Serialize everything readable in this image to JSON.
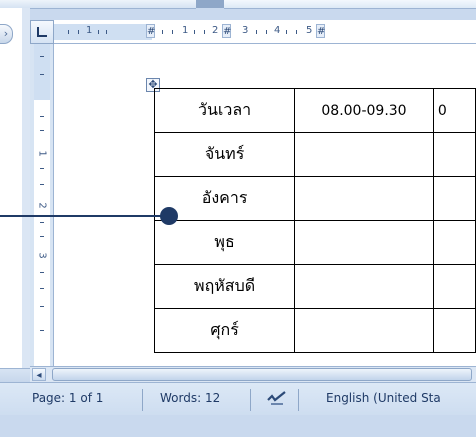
{
  "ruler": {
    "h_numbers": [
      "1",
      "1",
      "1",
      "2",
      "3",
      "4",
      "5"
    ],
    "v_numbers": [
      "1",
      "2",
      "3"
    ]
  },
  "table": {
    "header": [
      "วันเวลา",
      "08.00-09.30",
      "0"
    ],
    "days": [
      "จันทร์",
      "อังคาร",
      "พุธ",
      "พฤหัสบดี",
      "ศุกร์"
    ]
  },
  "status_bar": {
    "page": "Page: 1 of 1",
    "words": "Words: 12",
    "language": "English (United Sta"
  },
  "colors": {
    "accent": "#1f3a66",
    "chrome": "#c9d9ee"
  },
  "icons": {
    "tab_selector": "left-tab-icon",
    "table_move": "table-move-handle-icon",
    "proofing": "proofing-check-icon",
    "scroll_left": "scroll-left-arrow-icon",
    "left_pane_button": "pane-toggle-icon"
  }
}
